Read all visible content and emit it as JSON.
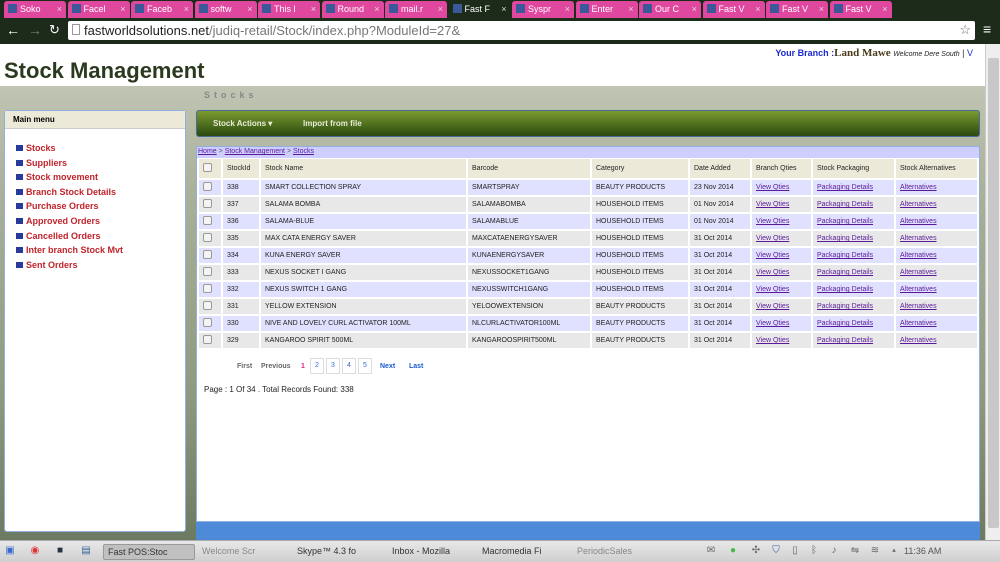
{
  "browser": {
    "tabs": [
      {
        "label": "Soko",
        "active": false
      },
      {
        "label": "Facel",
        "active": false
      },
      {
        "label": "Faceb",
        "active": false
      },
      {
        "label": "softw",
        "active": false
      },
      {
        "label": "This l",
        "active": false
      },
      {
        "label": "Round",
        "active": false
      },
      {
        "label": "mail.r",
        "active": false
      },
      {
        "label": "Fast F",
        "active": true
      },
      {
        "label": "Syspr",
        "active": false
      },
      {
        "label": "Enter",
        "active": false
      },
      {
        "label": "Our C",
        "active": false
      },
      {
        "label": "Fast V",
        "active": false
      },
      {
        "label": "Fast V",
        "active": false
      },
      {
        "label": "Fast V",
        "active": false
      }
    ],
    "url_domain": "fastworldsolutions.net",
    "url_path": "/judiq-retail/Stock/index.php?ModuleId=27&"
  },
  "header": {
    "branch_label": "Your Branch :",
    "branch_name": "Land Mawe",
    "welcome": "Welcome Dere South",
    "separator": "|",
    "user_link": "V",
    "title": "Stock Management",
    "section": "Stocks"
  },
  "sidebar": {
    "title": "Main menu",
    "items": [
      "Stocks",
      "Suppliers",
      "Stock movement",
      "Branch Stock Details",
      "Purchase Orders",
      "Approved Orders",
      "Cancelled Orders",
      "Inter branch Stock Mvt",
      "Sent Orders"
    ]
  },
  "actions": {
    "stock_actions": "Stock Actions",
    "import": "Import from file"
  },
  "breadcrumb": {
    "home": "Home",
    "sep": ">",
    "module": "Stock Management",
    "page": "Stocks"
  },
  "table": {
    "columns": [
      "StockId",
      "Stock Name",
      "Barcode",
      "Category",
      "Date Added",
      "Branch Qties",
      "Stock Packaging",
      "Stock Alternatives"
    ],
    "rows": [
      {
        "id": "338",
        "name": "SMART COLLECTION SPRAY",
        "barcode": "SMARTSPRAY",
        "category": "BEAUTY PRODUCTS",
        "date": "23 Nov 2014",
        "qties": "View Qties",
        "packaging": "Packaging Details",
        "alternatives": "Alternatives"
      },
      {
        "id": "337",
        "name": "SALAMA BOMBA",
        "barcode": "SALAMABOMBA",
        "category": "HOUSEHOLD ITEMS",
        "date": "01 Nov 2014",
        "qties": "View Qties",
        "packaging": "Packaging Details",
        "alternatives": "Alternatives"
      },
      {
        "id": "336",
        "name": "SALAMA-BLUE",
        "barcode": "SALAMABLUE",
        "category": "HOUSEHOLD ITEMS",
        "date": "01 Nov 2014",
        "qties": "View Qties",
        "packaging": "Packaging Details",
        "alternatives": "Alternatives"
      },
      {
        "id": "335",
        "name": "MAX CATA ENERGY SAVER",
        "barcode": "MAXCATAENERGYSAVER",
        "category": "HOUSEHOLD ITEMS",
        "date": "31 Oct 2014",
        "qties": "View Qties",
        "packaging": "Packaging Details",
        "alternatives": "Alternatives"
      },
      {
        "id": "334",
        "name": "KUNA ENERGY SAVER",
        "barcode": "KUNAENERGYSAVER",
        "category": "HOUSEHOLD ITEMS",
        "date": "31 Oct 2014",
        "qties": "View Qties",
        "packaging": "Packaging Details",
        "alternatives": "Alternatives"
      },
      {
        "id": "333",
        "name": "NEXUS SOCKET I GANG",
        "barcode": "NEXUSSOCKET1GANG",
        "category": "HOUSEHOLD ITEMS",
        "date": "31 Oct 2014",
        "qties": "View Qties",
        "packaging": "Packaging Details",
        "alternatives": "Alternatives"
      },
      {
        "id": "332",
        "name": "NEXUS SWITCH 1 GANG",
        "barcode": "NEXUSSWITCH1GANG",
        "category": "HOUSEHOLD ITEMS",
        "date": "31 Oct 2014",
        "qties": "View Qties",
        "packaging": "Packaging Details",
        "alternatives": "Alternatives"
      },
      {
        "id": "331",
        "name": "YELLOW EXTENSION",
        "barcode": "YELOOWEXTENSION",
        "category": "BEAUTY PRODUCTS",
        "date": "31 Oct 2014",
        "qties": "View Qties",
        "packaging": "Packaging Details",
        "alternatives": "Alternatives"
      },
      {
        "id": "330",
        "name": "NIVE AND LOVELY CURL ACTIVATOR 100ML",
        "barcode": "NLCURLACTIVATOR100ML",
        "category": "BEAUTY PRODUCTS",
        "date": "31 Oct 2014",
        "qties": "View Qties",
        "packaging": "Packaging Details",
        "alternatives": "Alternatives"
      },
      {
        "id": "329",
        "name": "KANGAROO SPIRIT 500ML",
        "barcode": "KANGAROOSPIRIT500ML",
        "category": "BEAUTY PRODUCTS",
        "date": "31 Oct 2014",
        "qties": "View Qties",
        "packaging": "Packaging Details",
        "alternatives": "Alternatives"
      }
    ]
  },
  "pagination": {
    "first": "First",
    "previous": "Previous",
    "current": "1",
    "pages": [
      "2",
      "3",
      "4",
      "5"
    ],
    "next": "Next",
    "last": "Last",
    "info": "Page : 1 Of 34 . Total Records Found: 338"
  },
  "taskbar": {
    "items": [
      {
        "label": "Fast POS:Stoc",
        "active": true
      },
      {
        "label": "Welcome Scr",
        "active": false
      },
      {
        "label": "Skype™ 4.3 fo",
        "active": false
      },
      {
        "label": "Inbox - Mozilla",
        "active": false
      },
      {
        "label": "Macromedia Fi",
        "active": false
      },
      {
        "label": "PeriodicSales",
        "active": false
      }
    ],
    "clock": "11:36 AM"
  }
}
